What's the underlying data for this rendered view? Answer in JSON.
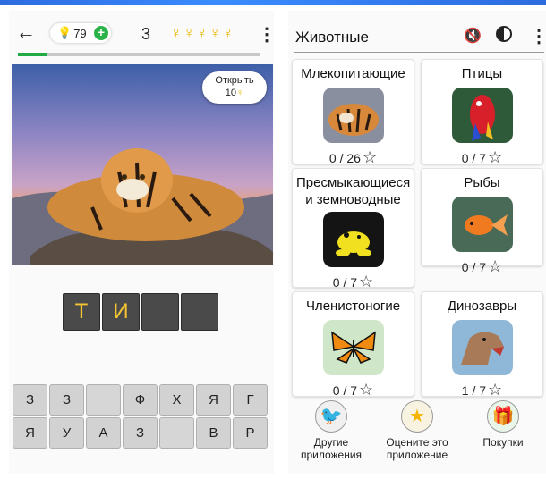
{
  "game": {
    "coins": "79",
    "level": "3",
    "progress_fraction": 0.12,
    "open_button": {
      "label": "Открыть",
      "cost": "10"
    },
    "answer_letters": [
      "Т",
      "И",
      "",
      ""
    ],
    "keyboard_rows": [
      [
        "З",
        "З",
        "",
        "Ф",
        "Х",
        "Я",
        "Г"
      ],
      [
        "Я",
        "У",
        "А",
        "З",
        "",
        "В",
        "Р"
      ]
    ]
  },
  "categories_screen": {
    "title": "Животные",
    "cards": [
      {
        "title": "Млекопитающие",
        "count": "0 / 26"
      },
      {
        "title": "Птицы",
        "count": "0 / 7"
      },
      {
        "title": "Пресмыкающиеся и земноводные",
        "count": "0 / 7"
      },
      {
        "title": "Рыбы",
        "count": "0 / 7"
      },
      {
        "title": "Членистоногие",
        "count": "0 / 7"
      },
      {
        "title": "Динозавры",
        "count": "1 / 7"
      }
    ],
    "bottom_nav": [
      {
        "label": "Другие приложения"
      },
      {
        "label": "Оцените это приложение"
      },
      {
        "label": "Покупки"
      }
    ]
  },
  "colors": {
    "accent_yellow": "#f5c531",
    "progress_green": "#22aa44",
    "top_bar_blue": "#2d6cdf"
  }
}
